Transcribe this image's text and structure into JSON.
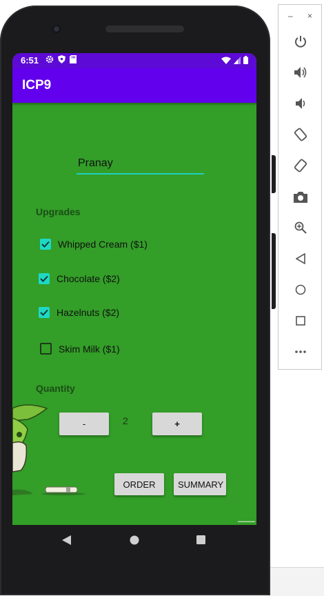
{
  "status_bar": {
    "time": "6:51"
  },
  "app_bar": {
    "title": "ICP9"
  },
  "form": {
    "name_value": "Pranay",
    "upgrades_label": "Upgrades",
    "toppings": [
      {
        "label": "Whipped Cream ($1)",
        "checked": true
      },
      {
        "label": "Chocolate ($2)",
        "checked": true
      },
      {
        "label": "Hazelnuts ($2)",
        "checked": true
      },
      {
        "label": "Skim Milk ($1)",
        "checked": false
      }
    ],
    "quantity_label": "Quantity",
    "minus_label": "-",
    "quantity_value": "2",
    "plus_label": "+",
    "order_label": "ORDER",
    "summary_label": "SUMMARY"
  },
  "colors": {
    "status_bar": "#5e0ad6",
    "app_bar": "#6200ee",
    "background": "#339e28",
    "accent": "#1ed8c5"
  },
  "emulator": {
    "top_controls": [
      "minimize",
      "close"
    ],
    "tools": [
      "power-icon",
      "volume-up-icon",
      "volume-down-icon",
      "rotate-left-icon",
      "rotate-right-icon",
      "camera-icon",
      "zoom-icon",
      "back-icon",
      "home-icon",
      "overview-icon",
      "more-icon"
    ]
  }
}
